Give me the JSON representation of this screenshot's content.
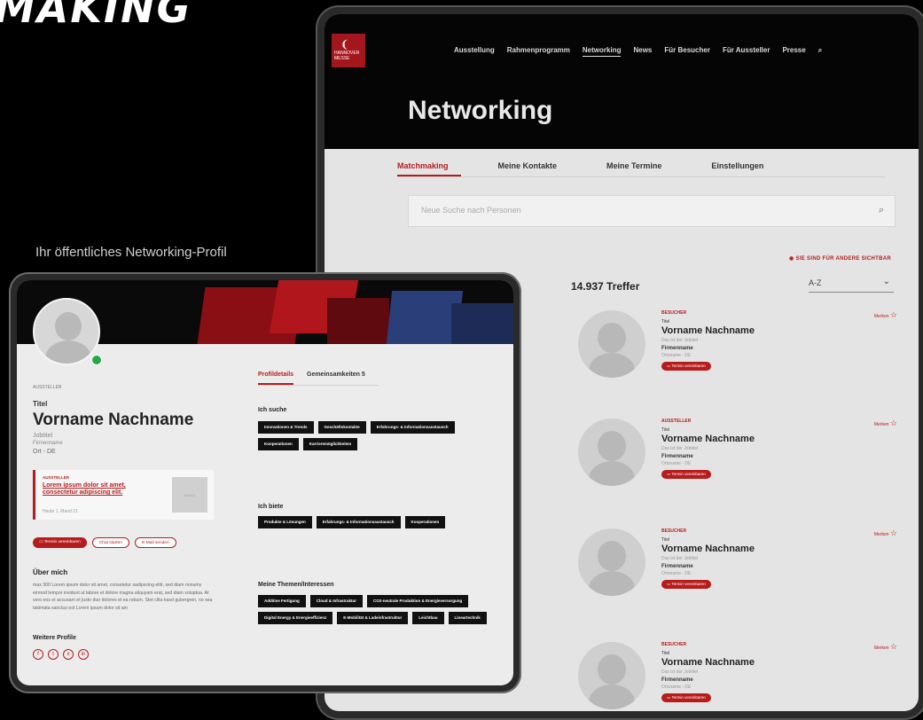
{
  "headline": "MAKING",
  "caption": "Ihr öffentliches Networking-Profil",
  "back": {
    "brand_text": "HANNOVER MESSE",
    "nav": [
      "Ausstellung",
      "Rahmenprogramm",
      "Networking",
      "News",
      "Für Besucher",
      "Für Aussteller",
      "Presse"
    ],
    "page_title": "Networking",
    "subtabs": [
      "Matchmaking",
      "Meine Kontakte",
      "Meine Termine",
      "Einstellungen"
    ],
    "search_placeholder": "Neue Suche nach Personen",
    "visible_note": "SIE SIND FÜR ANDERE SICHTBAR",
    "hits": "14.937 Treffer",
    "sort_value": "A-Z",
    "cards": [
      {
        "role": "BESUCHER",
        "title": "Titel",
        "name": "Vorname Nachname",
        "job": "Das ist der Jobtitel",
        "firm": "Firmenname",
        "loc": "Ortsname - DE",
        "button": "Termin vereinbaren",
        "merken": "Merken"
      },
      {
        "role": "AUSSTELLER",
        "title": "Titel",
        "name": "Vorname Nachname",
        "job": "Das ist der Jobtitel",
        "firm": "Firmenname",
        "loc": "Ortsname - DE",
        "button": "Termin vereinbaren",
        "merken": "Merken"
      },
      {
        "role": "BESUCHER",
        "title": "Titel",
        "name": "Vorname Nachname",
        "job": "Das ist der Jobtitel",
        "firm": "Firmenname",
        "loc": "Ortsname - DE",
        "button": "Termin vereinbaren",
        "merken": "Merken"
      },
      {
        "role": "BESUCHER",
        "title": "Titel",
        "name": "Vorname Nachname",
        "job": "Das ist der Jobtitel",
        "firm": "Firmenname",
        "loc": "Ortsname - DE",
        "button": "Termin vereinbaren",
        "merken": "Merken"
      }
    ]
  },
  "front": {
    "role": "AUSSTELLER",
    "title": "Titel",
    "name": "Vorname Nachname",
    "job": "Jobtitel",
    "firm": "Firmenname",
    "loc": "Ort - DE",
    "post": {
      "role": "AUSSTELLER",
      "title": "Lorem ipsum dolor sit amet, consectetur adipiscing elit.",
      "date": "Heute 1. Mand 21",
      "image_label": "IMAGE"
    },
    "buttons": [
      "Termin vereinbaren",
      "Chat starten",
      "E-Mail senden"
    ],
    "about_heading": "Über mich",
    "about_text": "max 300 Lorem ipsum dolor sit amet, consetetur sadipscing elitr, sed diam nonumy eirmod tempor invidunt ut labore et dolore magna aliquyam erat, sed diam voluptua. At vero eos et accusam et justo duo dolores et ea rebum. Stet clita kasd gubergren, no sea takimata sanctus est Lorem ipsum dolor sit am",
    "more_heading": "Weitere Profile",
    "tabs": [
      "Profildetails",
      "Gemeinsamkeiten"
    ],
    "tab_count": "5",
    "seek_heading": "Ich suche",
    "seek_tags": [
      "Innovationen & Trends",
      "Geschäftskontakte",
      "Erfahrungs- & Informationsaustausch",
      "Kooperationen",
      "Karrieremöglichkeiten"
    ],
    "offer_heading": "Ich biete",
    "offer_tags": [
      "Produkte & Lösungen",
      "Erfahrungs- & Informationsaustausch",
      "Kooperationen"
    ],
    "topics_heading": "Meine Themen/Interessen",
    "topic_tags": [
      "Additive Fertigung",
      "Cloud & Infrastruktur",
      "CO2-neutrale Produktion & Energieversorgung",
      "Digital Energy & Energieeffizienz",
      "E-Mobilität & Ladeinfrastruktur",
      "Leichtbau",
      "Lineartechnik"
    ]
  }
}
